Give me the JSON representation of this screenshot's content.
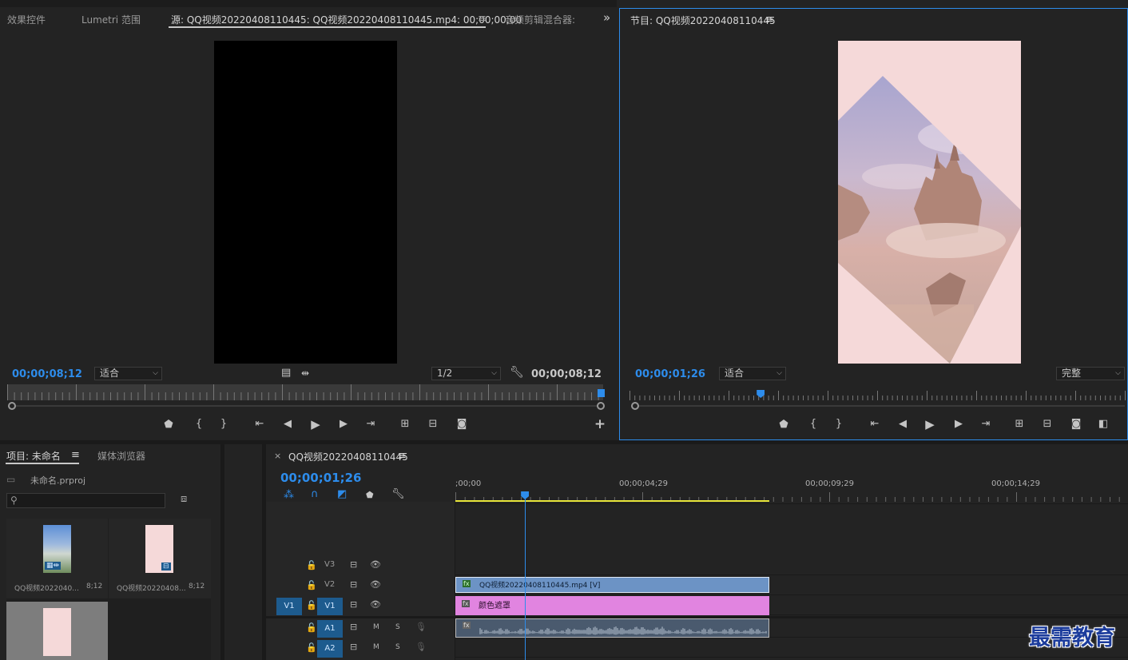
{
  "source_panel": {
    "tabs": [
      "效果控件",
      "Lumetri 范围",
      "源: QQ视频20220408110445: QQ视频20220408110445.mp4: 00;00;00;00",
      "音频剪辑混合器:"
    ],
    "menu_glyph": "≡",
    "overflow_glyph": "»",
    "timecode_left": "00;00;08;12",
    "fit_select": "适合",
    "quality_select": "1/2",
    "timecode_right": "00;00;08;12",
    "add_glyph": "+"
  },
  "program_panel": {
    "title": "节目: QQ视频20220408110445",
    "menu_glyph": "≡",
    "timecode": "00;00;01;26",
    "fit_select": "适合",
    "quality_select": "完整",
    "playhead_fraction": 0.264
  },
  "project_panel": {
    "tab_project": "项目: 未命名",
    "tab_media": "媒体浏览器",
    "menu_glyph": "≡",
    "project_file": "未命名.prproj",
    "search_placeholder": "",
    "items": [
      {
        "name": "QQ视频2022040...",
        "duration": "8;12"
      },
      {
        "name": "QQ视频20220408...",
        "duration": "8;12"
      },
      {
        "name": "",
        "duration": ""
      }
    ]
  },
  "tools": [
    "selection-tool",
    "track-select-tool",
    "ripple-edit-tool",
    "razor-tool",
    "slip-tool",
    "pen-tool",
    "hand-tool",
    "type-tool"
  ],
  "timeline": {
    "close_glyph": "×",
    "sequence_name": "QQ视频20220408110445",
    "menu_glyph": "≡",
    "timecode": "00;00;01;26",
    "ruler_labels": [
      ";00;00",
      "00;00;04;29",
      "00;00;09;29",
      "00;00;14;29"
    ],
    "playhead_seconds": 1.87,
    "video_tracks": [
      {
        "label": "V3",
        "source": "",
        "lock": "🔓"
      },
      {
        "label": "V2",
        "source": "",
        "lock": "🔓"
      },
      {
        "label": "V1",
        "source": "V1",
        "lock": "🔓"
      }
    ],
    "audio_tracks": [
      {
        "label": "A1",
        "m": "M",
        "s": "S"
      },
      {
        "label": "A2",
        "m": "M",
        "s": "S"
      }
    ],
    "clips": {
      "v2_clip": "QQ视频20220408110445.mp4 [V]",
      "v1_clip": "颜色遮罩"
    }
  },
  "watermark": "最需教育",
  "colors": {
    "accent": "#2d8ceb",
    "video_clip": "#6c93c5",
    "matte_clip": "#e184e0",
    "audio_clip": "#4a5a6e",
    "work_area": "#e8e53a",
    "program_bg": "#f5d9d9"
  }
}
